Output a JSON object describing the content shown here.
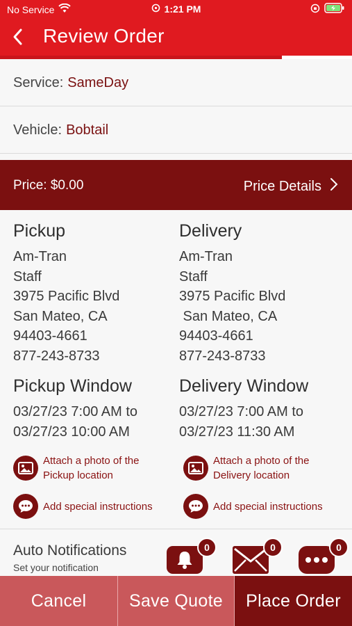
{
  "status_bar": {
    "carrier": "No Service",
    "time": "1:21 PM"
  },
  "nav": {
    "title": "Review Order",
    "progress_fraction": 0.8
  },
  "service": {
    "label": "Service:",
    "value": "SameDay"
  },
  "vehicle": {
    "label": "Vehicle:",
    "value": "Bobtail"
  },
  "price": {
    "label": "Price: $0.00",
    "details_label": "Price Details"
  },
  "pickup": {
    "heading": "Pickup",
    "lines": [
      "Am-Tran",
      "Staff",
      "3975 Pacific Blvd",
      "San Mateo, CA",
      "94403-4661",
      "877-243-8733"
    ],
    "window_heading": "Pickup Window",
    "window_lines": [
      "03/27/23 7:00 AM to",
      "03/27/23 10:00 AM"
    ],
    "photo_action": [
      "Attach a photo of the",
      "Pickup location"
    ],
    "instructions_action": "Add special instructions"
  },
  "delivery": {
    "heading": "Delivery",
    "lines": [
      "Am-Tran",
      "Staff",
      "3975 Pacific Blvd",
      " San Mateo, CA",
      "94403-4661",
      "877-243-8733"
    ],
    "window_heading": "Delivery Window",
    "window_lines": [
      "03/27/23 7:00 AM to",
      "03/27/23 11:30 AM"
    ],
    "photo_action": [
      "Attach a photo of the",
      "Delivery location"
    ],
    "instructions_action": "Add special instructions"
  },
  "notifications": {
    "title": "Auto Notifications",
    "subtitle": "Set your notification",
    "bell_count": "0",
    "mail_count": "0",
    "chat_count": "0"
  },
  "buttons": {
    "cancel": "Cancel",
    "save_quote": "Save Quote",
    "place_order": "Place Order"
  },
  "colors": {
    "brand_red": "#e01a20",
    "dark_red": "#7b1010",
    "muted_red": "#c9585b"
  }
}
